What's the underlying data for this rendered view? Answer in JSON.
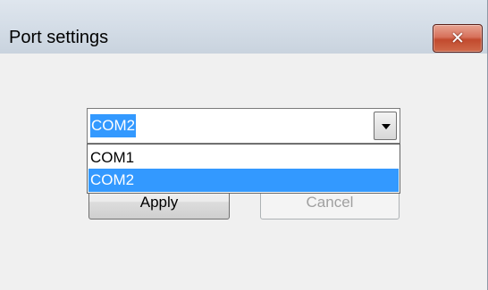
{
  "window": {
    "title": "Port settings",
    "close_glyph": "✕"
  },
  "port_combo": {
    "value": "COM2",
    "options": [
      {
        "label": "COM1",
        "selected": false
      },
      {
        "label": "COM2",
        "selected": true
      }
    ]
  },
  "buttons": {
    "apply_label": "Apply",
    "cancel_label": "Cancel"
  },
  "colors": {
    "selection": "#3399ff",
    "close_button": "#c24a2e",
    "window_background": "#f0f0f0"
  },
  "icons": {
    "close": "close-icon",
    "dropdown_arrow": "chevron-down-icon"
  }
}
